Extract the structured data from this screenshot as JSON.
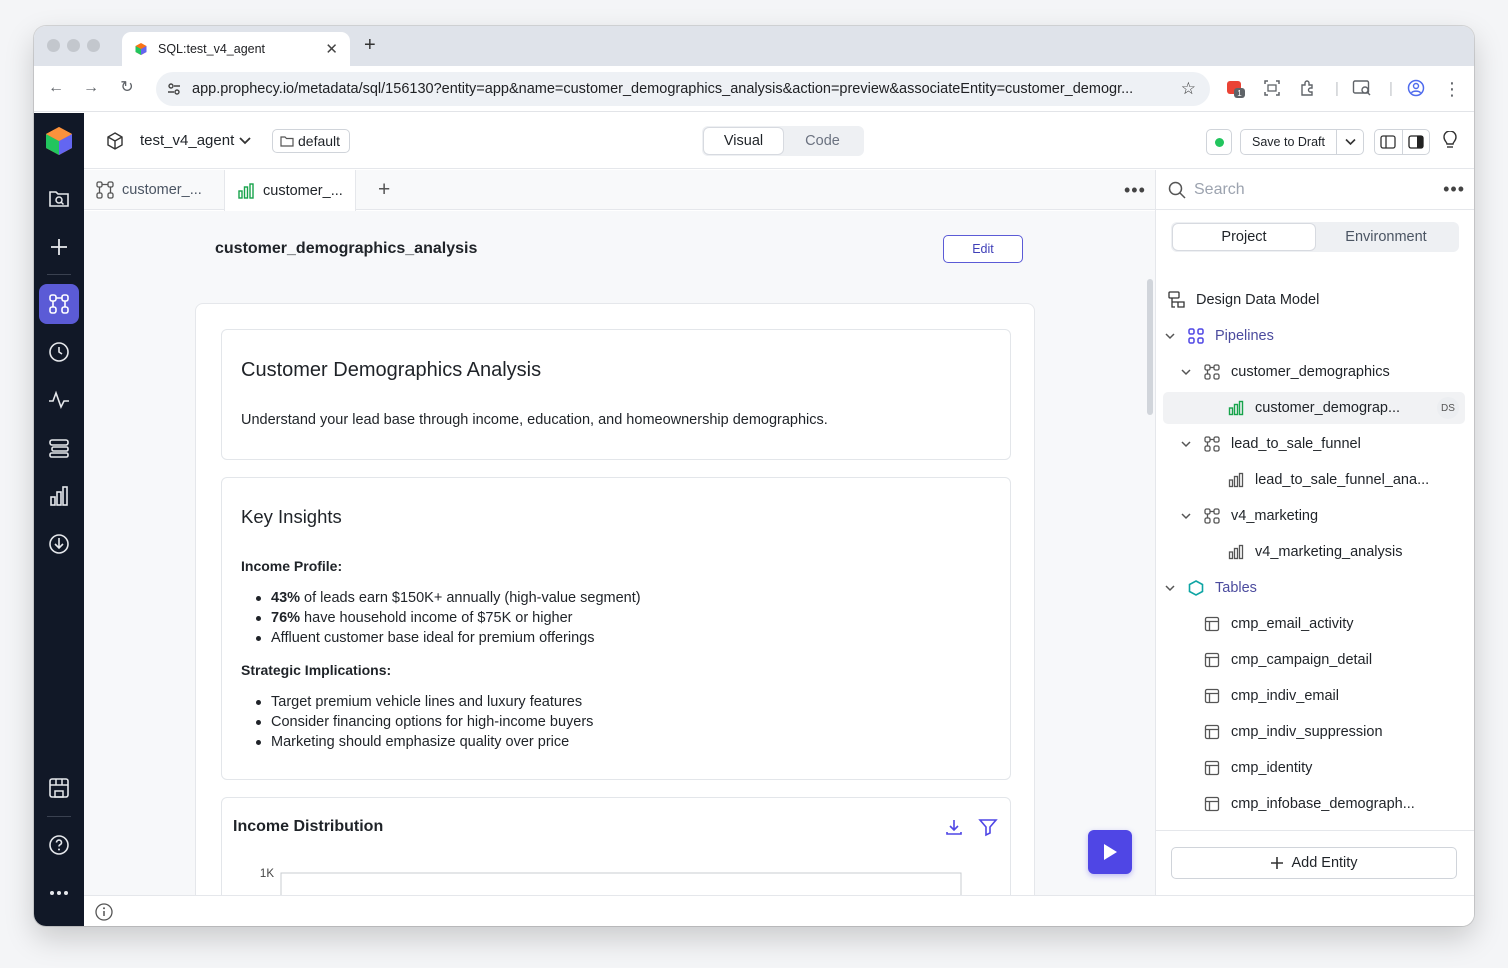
{
  "browser": {
    "tab_title": "SQL:test_v4_agent",
    "url": "app.prophecy.io/metadata/sql/156130?entity=app&name=customer_demographics_analysis&action=preview&associateEntity=customer_demogr...",
    "badge_count": "1"
  },
  "app": {
    "project_name": "test_v4_agent",
    "branch": "default",
    "view_modes": [
      "Visual",
      "Code"
    ],
    "active_view": "Visual",
    "save_label": "Save to Draft"
  },
  "editor_tabs": [
    {
      "label": "customer_...",
      "icon": "pipeline-icon"
    },
    {
      "label": "customer_...",
      "icon": "chart-icon"
    }
  ],
  "page": {
    "title": "customer_demographics_analysis",
    "edit_label": "Edit"
  },
  "report": {
    "heading": "Customer Demographics Analysis",
    "lead": "Understand your lead base through income, education, and homeownership demographics.",
    "insights": {
      "heading": "Key Insights",
      "income_heading": "Income Profile:",
      "income_items": [
        {
          "strong": "43%",
          "rest": " of leads earn $150K+ annually (high-value segment)"
        },
        {
          "strong": "76%",
          "rest": " have household income of $75K or higher"
        },
        {
          "strong": "",
          "rest": "Affluent customer base ideal for premium offerings"
        }
      ],
      "strategy_heading": "Strategic Implications:",
      "strategy_items": [
        "Target premium vehicle lines and luxury features",
        "Consider financing options for high-income buyers",
        "Marketing should emphasize quality over price"
      ]
    },
    "chart": {
      "title": "Income Distribution"
    }
  },
  "chart_data": {
    "type": "bar",
    "title": "Income Distribution",
    "y_ticks": [
      "1K"
    ]
  },
  "right_panel": {
    "search_placeholder": "Search",
    "tabs": [
      "Project",
      "Environment"
    ],
    "active_tab": "Project",
    "design_model": "Design Data Model",
    "pipelines_label": "Pipelines",
    "pipelines": [
      {
        "name": "customer_demographics",
        "child": "customer_demograp...",
        "child_badge": "DS"
      },
      {
        "name": "lead_to_sale_funnel",
        "child": "lead_to_sale_funnel_ana..."
      },
      {
        "name": "v4_marketing",
        "child": "v4_marketing_analysis"
      }
    ],
    "tables_label": "Tables",
    "tables": [
      "cmp_email_activity",
      "cmp_campaign_detail",
      "cmp_indiv_email",
      "cmp_indiv_suppression",
      "cmp_identity",
      "cmp_infobase_demograph..."
    ],
    "add_entity_label": "Add Entity"
  },
  "colors": {
    "accent": "#5b5bd6",
    "rail_bg": "#111827",
    "status_green": "#22c55e",
    "chart_icon_green": "#16a34a"
  }
}
